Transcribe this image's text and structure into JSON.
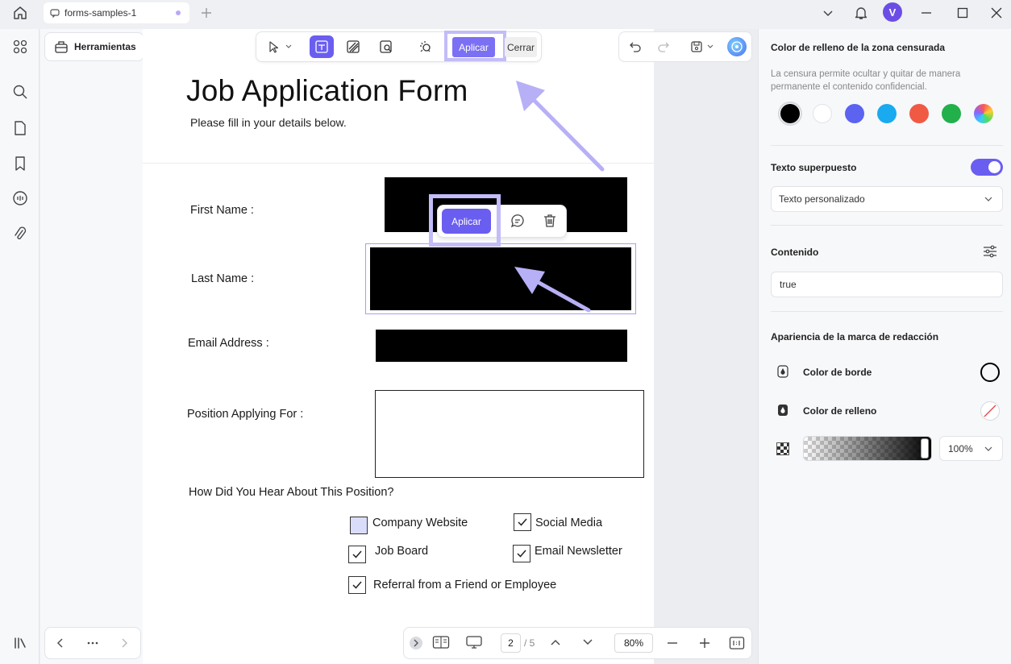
{
  "tab": {
    "title": "forms-samples-1"
  },
  "user": {
    "initial": "V"
  },
  "tools": {
    "label": "Herramientas"
  },
  "toolbar": {
    "apply_label": "Aplicar",
    "close_label": "Cerrar"
  },
  "popup": {
    "apply_label": "Aplicar"
  },
  "form": {
    "title": "Job Application Form",
    "subtitle": "Please fill in your details below.",
    "first_name_label": "First Name :",
    "last_name_label": "Last Name :",
    "email_label": "Email Address :",
    "position_label": "Position Applying For :",
    "how_heard_label": "How Did You Hear About This Position?",
    "options": [
      {
        "label": "Company Website",
        "checked": false
      },
      {
        "label": "Social Media",
        "checked": true
      },
      {
        "label": "Job Board",
        "checked": true
      },
      {
        "label": "Email Newsletter",
        "checked": true
      },
      {
        "label": "Referral from a Friend or Employee",
        "checked": true
      }
    ]
  },
  "pagination": {
    "current": "2",
    "total": "/ 5",
    "zoom": "80%"
  },
  "panel": {
    "fill_zone_title": "Color de relleno de la zona censurada",
    "fill_zone_desc": "La censura permite ocultar y quitar de manera permanente el contenido confidencial.",
    "swatches": [
      "#000000",
      "#ffffff",
      "#5b63f0",
      "#19aaf0",
      "#f05a44",
      "#22b04b",
      "rainbow"
    ],
    "overlay_text_label": "Texto superpuesto",
    "overlay_text_enabled": true,
    "overlay_select_value": "Texto personalizado",
    "content_label": "Contenido",
    "content_value": "true",
    "appearance_label": "Apariencia de la marca de redacción",
    "border_color_label": "Color de borde",
    "fill_color_label": "Color de relleno",
    "opacity_value": "100%"
  },
  "colors": {
    "accent": "#6a5ef0",
    "highlight": "#c2bcf8"
  }
}
